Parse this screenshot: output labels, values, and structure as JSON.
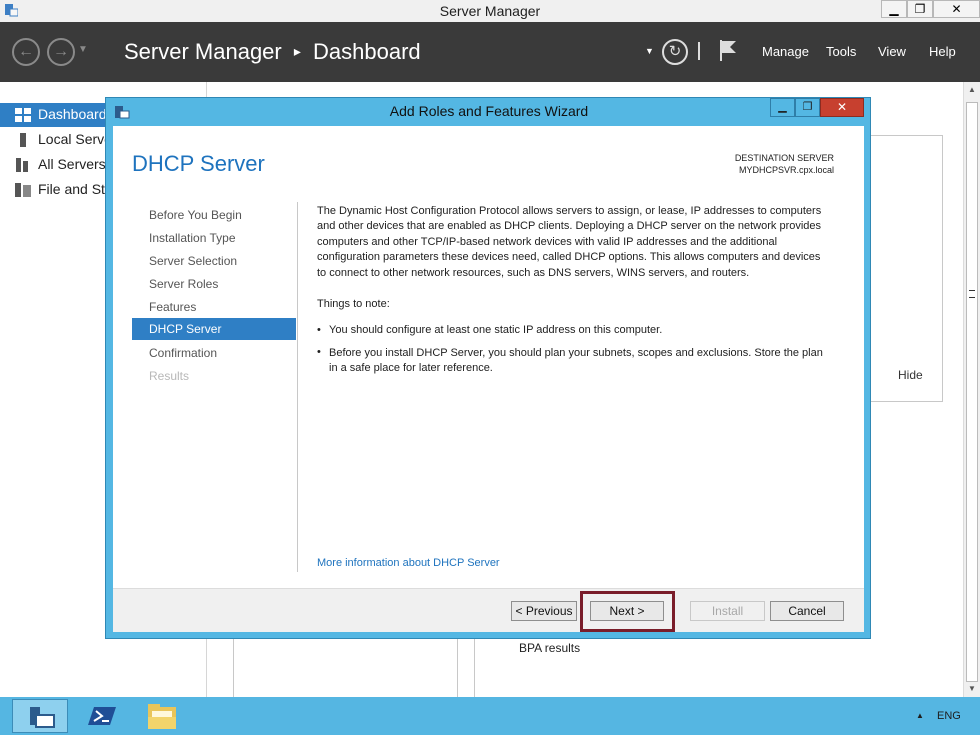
{
  "window": {
    "title": "Server Manager",
    "controls": {
      "minimize": "▁",
      "restore": "❐",
      "close": "✕"
    }
  },
  "header": {
    "title": "Server Manager",
    "separator": "▸",
    "page": "Dashboard",
    "menu": {
      "manage": "Manage",
      "tools": "Tools",
      "view": "View",
      "help": "Help"
    }
  },
  "nav": {
    "items": [
      {
        "label": "Dashboard",
        "icon": "dashboard-icon",
        "selected": true
      },
      {
        "label": "Local Server",
        "icon": "server-icon"
      },
      {
        "label": "All Servers",
        "icon": "servers-icon"
      },
      {
        "label": "File and Storage Services",
        "icon": "storage-icon"
      }
    ]
  },
  "background": {
    "hide_label": "Hide",
    "bpa_label": "BPA results"
  },
  "wizard": {
    "title": "Add Roles and Features Wizard",
    "page_title": "DHCP Server",
    "destination_label": "DESTINATION SERVER",
    "destination_server": "MYDHCPSVR.cpx.local",
    "steps": [
      {
        "label": "Before You Begin",
        "state": "done"
      },
      {
        "label": "Installation Type",
        "state": "done"
      },
      {
        "label": "Server Selection",
        "state": "done"
      },
      {
        "label": "Server Roles",
        "state": "done"
      },
      {
        "label": "Features",
        "state": "done"
      },
      {
        "label": "DHCP Server",
        "state": "current"
      },
      {
        "label": "Confirmation",
        "state": "todo"
      },
      {
        "label": "Results",
        "state": "disabled"
      }
    ],
    "description_lines": [
      "The Dynamic Host Configuration Protocol allows servers to assign, or lease, IP addresses to computers",
      "and other devices that are enabled as DHCP clients. Deploying a DHCP server on the network provides",
      "computers and other TCP/IP-based network devices with valid IP addresses and the additional",
      "configuration parameters these devices need, called DHCP options. This allows computers and devices",
      "to connect to other network resources, such as DNS servers, WINS servers, and routers."
    ],
    "notes_heading": "Things to note:",
    "note1": "You should configure at least one static IP address on this computer.",
    "note2_lines": [
      "Before you install DHCP Server, you should plan your subnets, scopes and exclusions. Store the plan",
      "in a safe place for later reference."
    ],
    "more_info_link": "More information about DHCP Server",
    "buttons": {
      "previous": "< Previous",
      "next": "Next >",
      "install": "Install",
      "cancel": "Cancel"
    }
  },
  "taskbar": {
    "language": "ENG",
    "tray_arrow": "▲"
  },
  "colors": {
    "accent": "#1e73be",
    "wizard_frame": "#54b7e3",
    "header": "#3a3a3a",
    "highlight_box": "#7a1d2a"
  }
}
